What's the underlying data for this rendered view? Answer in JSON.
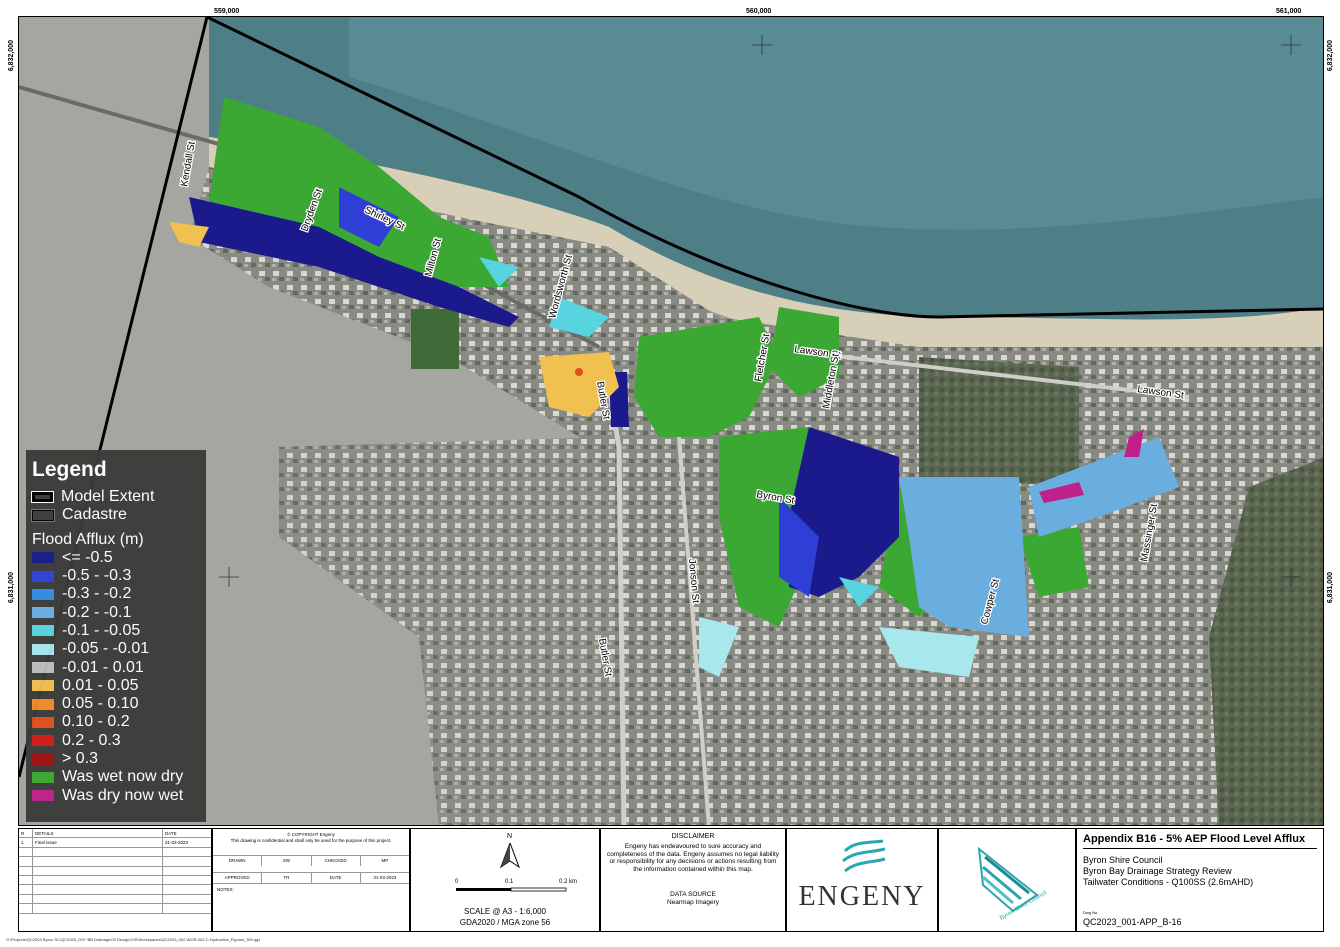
{
  "coords": {
    "top": [
      "559,000",
      "560,000",
      "561,000"
    ],
    "left": [
      "6,832,000",
      "6,831,000"
    ],
    "right": [
      "6,832,000",
      "6,831,000"
    ]
  },
  "streets": [
    "Kendall St",
    "Dryden St",
    "Shirley St",
    "Milton St",
    "Wordsworth St",
    "Butler St",
    "Fletcher St",
    "Lawson St",
    "Middleton St",
    "Lawson St",
    "Byron St",
    "Jonson St",
    "Butler St",
    "Cowper St",
    "Massinger St"
  ],
  "legend": {
    "title": "Legend",
    "model_extent": "Model Extent",
    "cadastre": "Cadastre",
    "section": "Flood Afflux (m)",
    "classes": [
      {
        "label": "<= -0.5",
        "color": "#1a1a8c"
      },
      {
        "label": "-0.5 - -0.3",
        "color": "#2f3fd6"
      },
      {
        "label": "-0.3 - -0.2",
        "color": "#2f8fe0"
      },
      {
        "label": "-0.2 - -0.1",
        "color": "#6aaee0"
      },
      {
        "label": "-0.1 - -0.05",
        "color": "#58d4e0"
      },
      {
        "label": "-0.05 - -0.01",
        "color": "#a8e8ec"
      },
      {
        "label": "-0.01 - 0.01",
        "color": "#bdbdbd"
      },
      {
        "label": "0.01 - 0.05",
        "color": "#f0c050"
      },
      {
        "label": "0.05 - 0.10",
        "color": "#f08a2a"
      },
      {
        "label": "0.10 - 0.2",
        "color": "#e0501c"
      },
      {
        "label": "0.2 - 0.3",
        "color": "#d01c14"
      },
      {
        "label": "> 0.3",
        "color": "#a00e0e"
      },
      {
        "label": "Was wet now dry",
        "color": "#3aa832"
      },
      {
        "label": "Was dry now wet",
        "color": "#c0208a"
      }
    ]
  },
  "revisions": {
    "headers": [
      "R",
      "DETAILS",
      "DATE"
    ],
    "rows": [
      [
        "1",
        "Final Issue",
        "31-03-2023"
      ]
    ]
  },
  "copyright": {
    "title": "© COPYRIGHT Engeny",
    "text": "This drawing is confidential and shall only be used for the purpose of this project.",
    "row1": [
      "DRAWN",
      "SW",
      "CHECKED",
      "MP"
    ],
    "row2": [
      "APPROVED",
      "TR",
      "DATE",
      "31-03-2023"
    ],
    "notes": "NOTES:"
  },
  "scale": {
    "north": "N",
    "ticks": [
      "0",
      "0.1",
      "0.2 km"
    ],
    "text": "SCALE @ A3 -  1:6,000",
    "datum": "GDA2020 / MGA zone 56"
  },
  "disclaimer": {
    "title": "DISCLAIMER",
    "text": "Engeny has endeavoured to sure accuracy and completeness of the data. Engeny assumes no legal liability or responsibility for any decisions or actions resulting from the information contained within this map.",
    "source_title": "DATA SOURCE",
    "source": "Nearmap Imagery"
  },
  "logos": {
    "engeny": "ENGENY",
    "council": "Byron Shire Council"
  },
  "title_block": {
    "title": "Appendix B16 - 5% AEP Flood Level Afflux",
    "line1": "Byron Shire Council",
    "line2": "Byron Bay Drainage Strategy Review",
    "line3": "Tailwater Conditions - Q100SS (2.6mAHD)",
    "dwg_label": "Dwg No.",
    "dwg_no": "QC2023_001-APP_B-16"
  },
  "footer_path": "G:\\Projects\\QC2003 Byron SC\\QC2003_002 *BB Drainage\\09 Design\\GIS\\Workspaces\\QC2003_002-WOR-002-C-Hydraulics_Figures_SW.qgz"
}
